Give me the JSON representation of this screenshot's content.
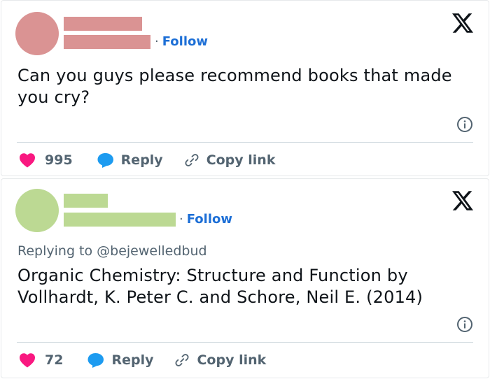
{
  "tweet1": {
    "avatar_color": "#da9393",
    "name_color": "#da9393",
    "follow_dot": "·",
    "follow_label": "Follow",
    "text": "Can you guys please recommend books that made you cry?",
    "likes": "995",
    "reply_label": "Reply",
    "copy_label": "Copy link"
  },
  "tweet2": {
    "avatar_color": "#bcd993",
    "name_color": "#bcd993",
    "follow_dot": "·",
    "follow_label": "Follow",
    "replying_to": "Replying to @bejewelledbud",
    "text": "Organic Chemistry: Structure and Function by Vollhardt, K. Peter C. and Schore, Neil E. (2014)",
    "likes": "72",
    "reply_label": "Reply",
    "copy_label": "Copy link"
  },
  "colors": {
    "heart": "#f91880",
    "reply_bubble": "#1d9bf0",
    "link": "#1d6fd6",
    "muted": "#536471"
  },
  "icons": {
    "logo": "x-logo-icon",
    "info": "info-icon",
    "heart": "heart-icon",
    "reply": "speech-bubble-icon",
    "copy": "link-icon"
  }
}
